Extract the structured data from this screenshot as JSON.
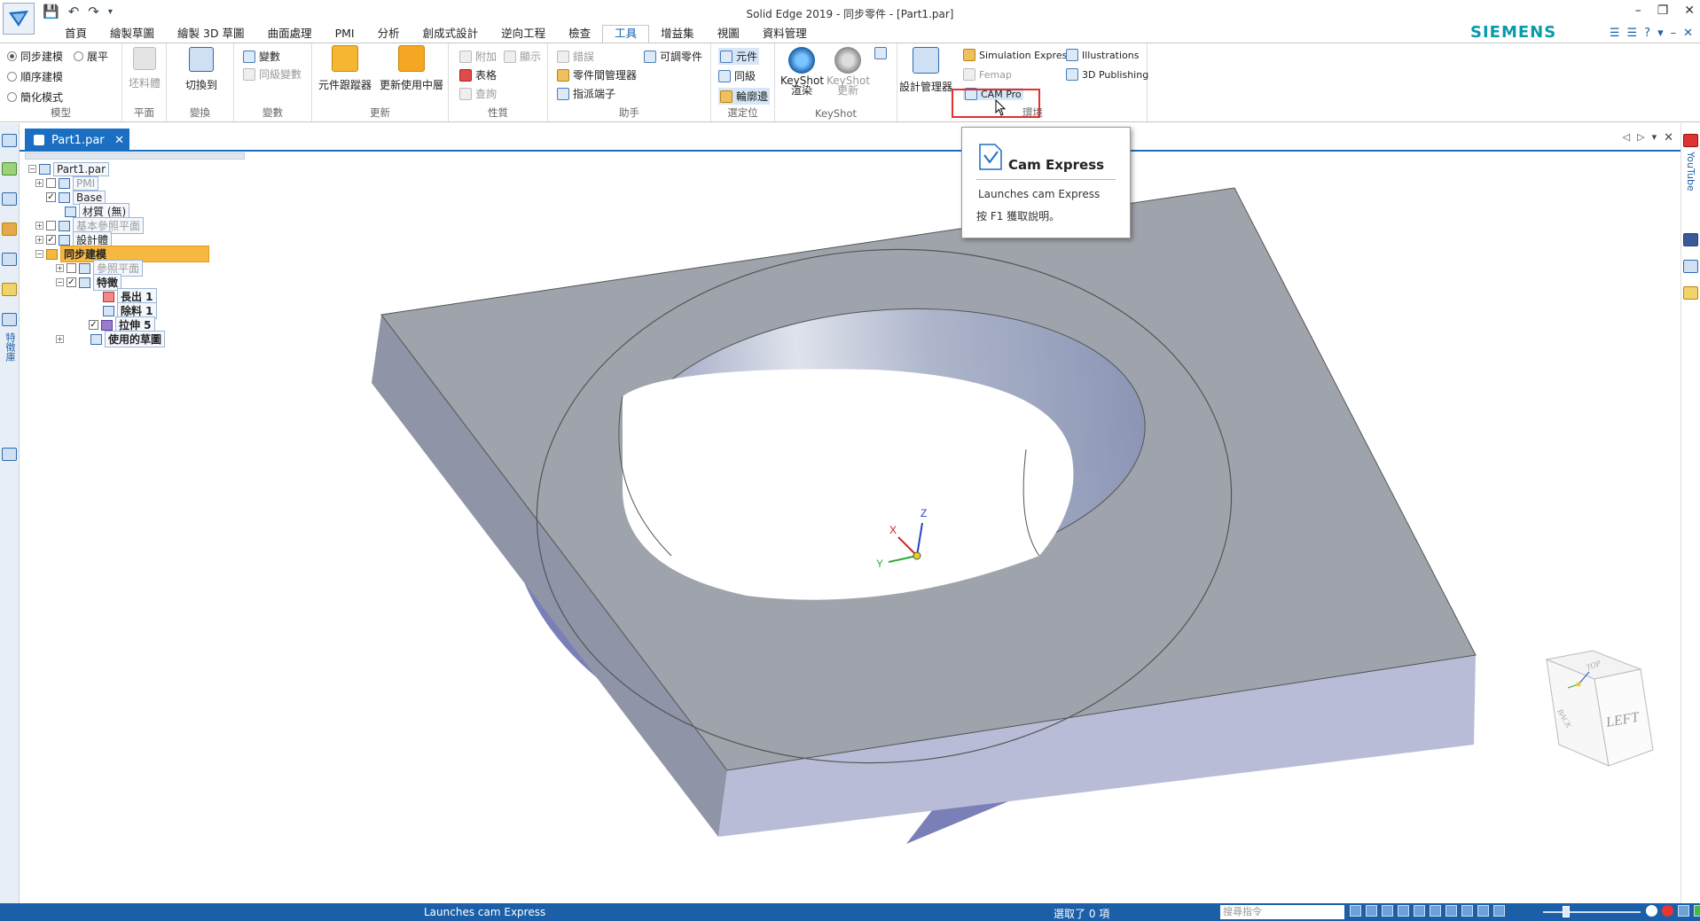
{
  "window": {
    "title": "Solid Edge 2019 - 同步零件 - [Part1.par]",
    "controls": [
      "–",
      "❐",
      "✕"
    ],
    "brand": "SIEMENS"
  },
  "qat": [
    "save-icon",
    "undo-icon",
    "redo-icon",
    "customize-icon"
  ],
  "tabs": [
    "首頁",
    "繪製草圖",
    "繪製 3D 草圖",
    "曲面處理",
    "PMI",
    "分析",
    "創成式設計",
    "逆向工程",
    "檢查",
    "工具",
    "增益集",
    "視圖",
    "資料管理"
  ],
  "active_tab": "工具",
  "ribbon": {
    "model": {
      "label": "模型",
      "opt1": "同步建模",
      "opt2": "順序建模",
      "opt3": "簡化模式",
      "opt4": "展平"
    },
    "plane": {
      "label": "平面",
      "btn": "坯料體"
    },
    "transform": {
      "label": "變換",
      "btn": "切換到"
    },
    "variables": {
      "label": "變數",
      "btn1": "變數",
      "btn2": "同級變數"
    },
    "update": {
      "label": "更新",
      "btn1": "元件跟蹤器",
      "btn2": "更新使用中層"
    },
    "props": {
      "label": "性質",
      "btn1": "附加",
      "btn2": "顯示",
      "btn3": "表格",
      "btn4": "查詢"
    },
    "assist": {
      "label": "助手",
      "btn1": "錯誤",
      "btn2": "可調零件",
      "btn3": "零件間管理器",
      "btn4": "指派端子"
    },
    "select": {
      "label": "選定位",
      "btn1": "元件",
      "btn2": "同級",
      "btn3": "輪廓邊"
    },
    "keyshot": {
      "label": "KeyShot",
      "btn1": "KeyShot",
      "btn1b": "渲染",
      "btn2": "KeyShot",
      "btn2b": "更新"
    },
    "design": {
      "label": "",
      "btn": "設計管理器"
    },
    "env": {
      "label": "環境",
      "btn1": "Simulation Express",
      "btn2": "Femap",
      "btn3": "CAM Pro",
      "btn4": "Illustrations",
      "btn5": "3D Publishing"
    }
  },
  "tooltip": {
    "title": "Cam Express",
    "desc": "Launches cam Express",
    "help": "按 F1 獲取說明。"
  },
  "doc": {
    "tab": "Part1.par"
  },
  "tree": {
    "root": "Part1.par",
    "pmi": "PMI",
    "base": "Base",
    "material": "材質 (無)",
    "refplanes": "基本參照平面",
    "designbody": "設計體",
    "sync": "同步建模",
    "refplane": "參照平面",
    "features": "特徵",
    "f1": "長出 1",
    "f2": "除料 1",
    "f3": "拉伸 5",
    "sketches": "使用的草圖"
  },
  "leftbar": {
    "label": "特徵庫"
  },
  "rightbar": {
    "label": "YouTube"
  },
  "triad": {
    "x": "X",
    "y": "Y",
    "z": "Z"
  },
  "viewcube": {
    "face": "LEFT",
    "top": "TOP",
    "back": "BACK"
  },
  "status": {
    "message": "Launches cam Express",
    "selection": "選取了 0 項",
    "search_placeholder": "搜尋指令"
  }
}
